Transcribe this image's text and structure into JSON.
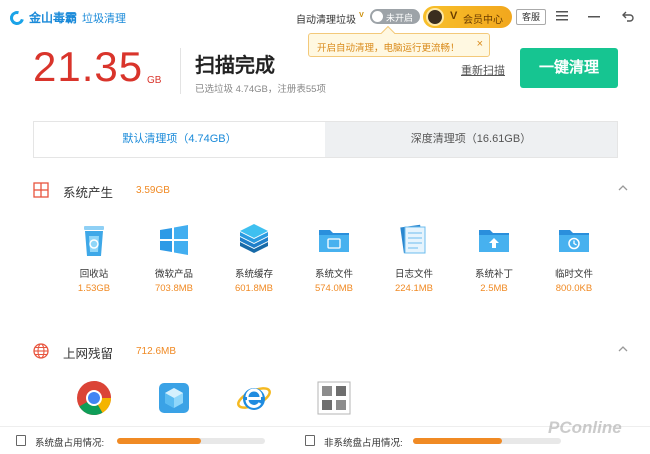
{
  "app": {
    "brand": "金山毒霸",
    "module": "垃圾清理",
    "auto_clean_label": "自动清理垃圾",
    "auto_clean_badge": "V",
    "toggle_text": "未开启",
    "vip_letter": "V",
    "vip_label": "会员中心",
    "feedback": "客服",
    "menu_icon": "menu-icon",
    "minimize_icon": "minimize-icon",
    "back_icon": "back-icon"
  },
  "tooltip": {
    "text": "开启自动清理，电脑运行更流畅！",
    "close": "×"
  },
  "summary": {
    "size": "21.35",
    "unit": "GB",
    "status": "扫描完成",
    "detail": "已选垃圾 4.74GB，注册表55项",
    "rescan": "重新扫描",
    "clean_button": "一键清理"
  },
  "tabs": [
    {
      "label": "默认清理项（4.74GB）",
      "active": true
    },
    {
      "label": "深度清理项（16.61GB）",
      "active": false
    }
  ],
  "sections": [
    {
      "title": "系统产生",
      "size": "3.59GB",
      "icon": "windows-grid-icon",
      "items": [
        {
          "name": "回收站",
          "size": "1.53GB",
          "icon": "recycle-bin-icon"
        },
        {
          "name": "微软产品",
          "size": "703.8MB",
          "icon": "windows-logo-icon"
        },
        {
          "name": "系统缓存",
          "size": "601.8MB",
          "icon": "layers-icon"
        },
        {
          "name": "系统文件",
          "size": "574.0MB",
          "icon": "folder-icon"
        },
        {
          "name": "日志文件",
          "size": "224.1MB",
          "icon": "log-file-icon"
        },
        {
          "name": "系统补丁",
          "size": "2.5MB",
          "icon": "patch-folder-icon"
        },
        {
          "name": "临时文件",
          "size": "800.0KB",
          "icon": "temp-folder-icon"
        }
      ]
    },
    {
      "title": "上网残留",
      "size": "712.6MB",
      "icon": "globe-icon",
      "items": [
        {
          "icon": "chrome-icon"
        },
        {
          "icon": "browser-cube-icon"
        },
        {
          "icon": "ie-icon"
        },
        {
          "icon": "app-grid-icon"
        }
      ]
    }
  ],
  "status": {
    "system_disk": "系统盘占用情况:",
    "system_disk_usage": 0.57,
    "other_disk": "非系统盘占用情况:",
    "other_disk_usage": 0.6,
    "watermark": "PConline"
  },
  "colors": {
    "accent_red": "#d9342b",
    "brand_blue": "#1a8ad9",
    "clean_green": "#16c591",
    "size_orange": "#f08a24"
  }
}
